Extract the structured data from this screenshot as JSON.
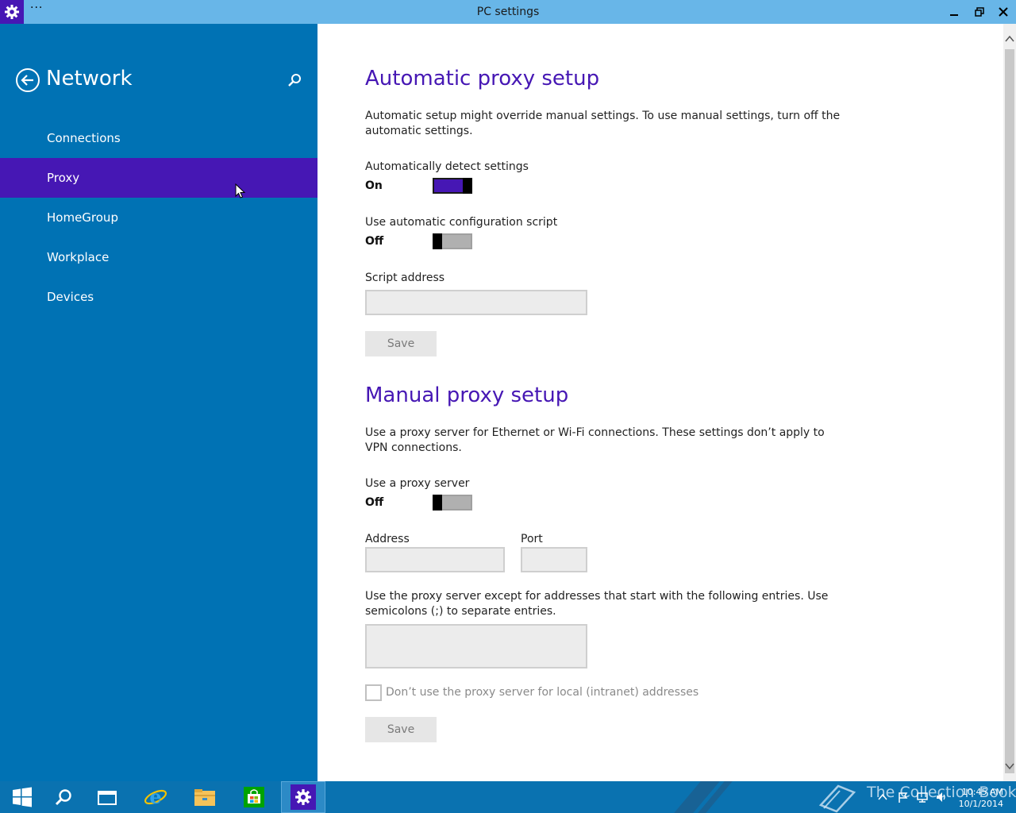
{
  "titlebar": {
    "menu": "···",
    "title": "PC settings",
    "icons": [
      "gear-icon",
      "minimize-icon",
      "restore-icon",
      "close-icon"
    ]
  },
  "sidebar": {
    "title": "Network",
    "items": [
      {
        "label": "Connections",
        "selected": false
      },
      {
        "label": "Proxy",
        "selected": true
      },
      {
        "label": "HomeGroup",
        "selected": false
      },
      {
        "label": "Workplace",
        "selected": false
      },
      {
        "label": "Devices",
        "selected": false
      }
    ]
  },
  "automatic": {
    "heading": "Automatic proxy setup",
    "description": "Automatic setup might override manual settings. To use manual settings, turn off the automatic settings.",
    "detect_label": "Automatically detect settings",
    "detect_state": "On",
    "script_label": "Use automatic configuration script",
    "script_state": "Off",
    "address_label": "Script address",
    "address_value": "",
    "save_label": "Save"
  },
  "manual": {
    "heading": "Manual proxy setup",
    "description": "Use a proxy server for Ethernet or Wi-Fi connections. These settings don’t apply to VPN connections.",
    "proxy_label": "Use a proxy server",
    "proxy_state": "Off",
    "address_label": "Address",
    "address_value": "",
    "port_label": "Port",
    "port_value": "",
    "exceptions_description": "Use the proxy server except for addresses that start with the following entries. Use semicolons (;) to separate entries.",
    "exceptions_value": "",
    "local_checkbox_label": "Don’t use the proxy server for local (intranet) addresses",
    "local_checked": false,
    "save_label": "Save"
  },
  "taskbar": {
    "apps": [
      "windows-start-icon",
      "search-icon",
      "task-view-icon",
      "internet-explorer-icon",
      "file-explorer-icon",
      "store-icon",
      "settings-icon"
    ],
    "watermark": "The Collection Book",
    "time": "10:45 AM",
    "date": "10/1/2014"
  },
  "colors": {
    "accent": "#4617b4",
    "sidebar": "#0072b4",
    "titlebar": "#68b6e8",
    "taskbar": "#0a72b0"
  }
}
